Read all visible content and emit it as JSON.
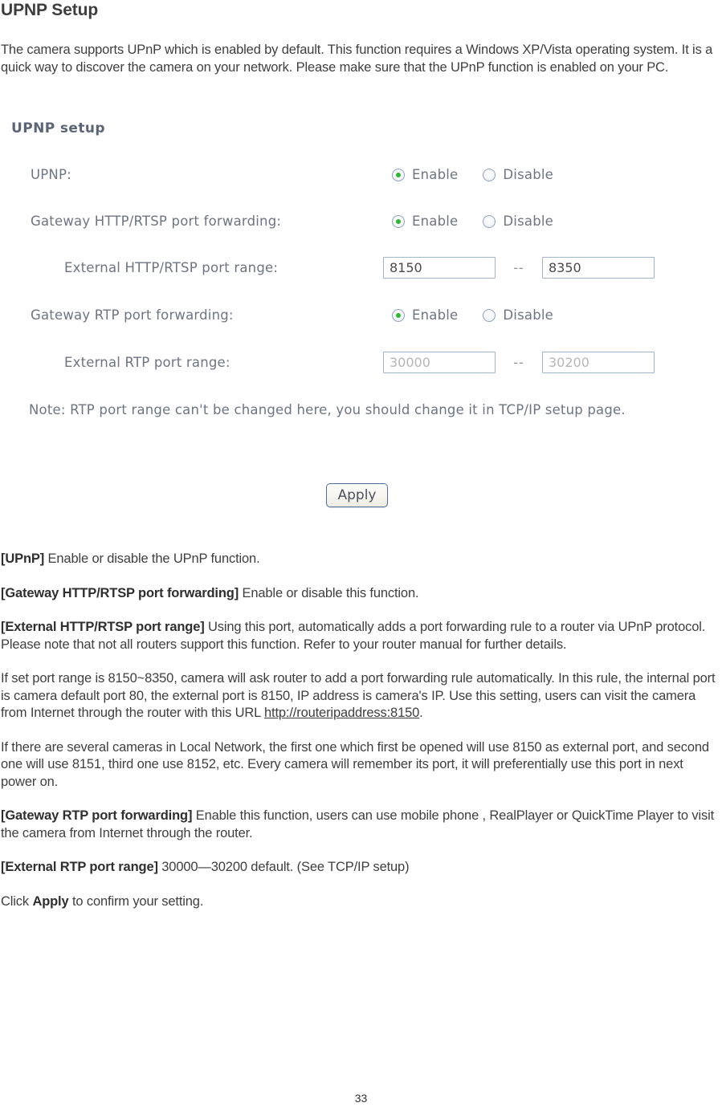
{
  "page": {
    "title": "UPNP Setup",
    "number": "33",
    "intro": "The camera supports UPnP which is enabled by default. This function requires a Windows XP/Vista operating system. It is a quick way to discover the camera on your network. Please make sure that the UPnP function is enabled on your PC."
  },
  "figure": {
    "title": "UPNP setup",
    "rows": [
      {
        "label": "UPNP:",
        "control": "radio",
        "options": [
          "Enable",
          "Disable"
        ],
        "selected": "Enable",
        "indent": "lvl1"
      },
      {
        "label": "Gateway HTTP/RTSP port forwarding:",
        "control": "radio",
        "options": [
          "Enable",
          "Disable"
        ],
        "selected": "Enable",
        "indent": "lvl1"
      },
      {
        "label": "External HTTP/RTSP port range:",
        "control": "range",
        "from": "8150",
        "to": "8350",
        "separator": "--",
        "disabled": false,
        "indent": "lvl2"
      },
      {
        "label": "Gateway RTP port forwarding:",
        "control": "radio",
        "options": [
          "Enable",
          "Disable"
        ],
        "selected": "Enable",
        "indent": "lvl1"
      },
      {
        "label": "External RTP port range:",
        "control": "range",
        "from": "30000",
        "to": "30200",
        "separator": "--",
        "disabled": true,
        "indent": "lvl2"
      }
    ],
    "note": "Note: RTP port range can't be changed here, you should change it in TCP/IP setup page.",
    "apply_label": "Apply",
    "colors": {
      "radio_selected_dot": "#2eb82e",
      "input_border": "#9fb4cd",
      "label_text": "#6d7583",
      "button_border": "#4f6d9c"
    }
  },
  "descriptions": {
    "upnp_term": "[UPnP]",
    "upnp_text": " Enable or disable the UPnP function.",
    "gw_http_term": "[Gateway HTTP/RTSP port forwarding]",
    "gw_http_text": " Enable or disable this function.",
    "ext_http_term": "[External HTTP/RTSP port range]",
    "ext_http_text": " Using this port, automatically adds a port forwarding rule to a router via UPnP protocol. Please note that not all routers support this function. Refer to your router manual for further details.",
    "rule_para_before_link": "If set port range is 8150~8350, camera will ask router to add a port forwarding rule automatically. In this rule, the internal port is camera default port 80, the external port is 8150, IP address is camera's IP. Use this setting, users can visit the camera from Internet through the router with this URL ",
    "rule_para_link": "http://routeripaddress:8150",
    "rule_para_after_link": ".",
    "multi_camera_para": "If there are several cameras in Local Network, the first one which first be opened will use 8150 as external port, and second one will use 8151, third one use 8152, etc. Every camera will remember its port, it will preferentially use this port in next power on.",
    "gw_rtp_term": "[Gateway RTP port forwarding]",
    "gw_rtp_text": " Enable this function, users can use mobile phone , RealPlayer or QuickTime Player to visit the camera from Internet through the router.",
    "ext_rtp_term": "[External RTP port range]",
    "ext_rtp_text": " 30000—30200 default. (See TCP/IP setup)",
    "click_prefix": "Click ",
    "click_bold": "Apply",
    "click_suffix": " to confirm your setting."
  }
}
